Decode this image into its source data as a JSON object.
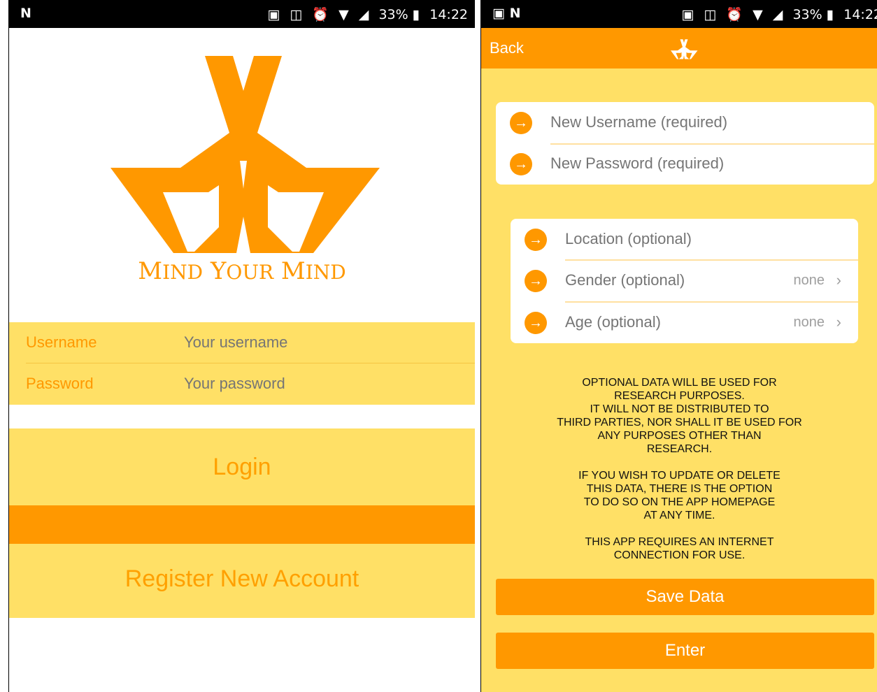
{
  "left": {
    "status": {
      "left_icon": "N",
      "battery": "33%",
      "time": "14:22"
    },
    "logo": {
      "text_big1": "M",
      "text_small1": "IND",
      "text_big2": "Y",
      "text_small2": "OUR",
      "text_big3": "M",
      "text_small3": "IND",
      "color": "#FF9800"
    },
    "username": {
      "label": "Username",
      "placeholder": "Your username"
    },
    "password": {
      "label": "Password",
      "placeholder": "Your password"
    },
    "login_label": "Login",
    "register_label": "Register New Account"
  },
  "right": {
    "status": {
      "left_icons": "▣ N",
      "battery": "33%",
      "time": "14:22"
    },
    "nav": {
      "back_label": "Back"
    },
    "fields1": [
      {
        "label": "New Username (required)"
      },
      {
        "label": "New Password (required)"
      }
    ],
    "fields2": [
      {
        "label": "Location (optional)",
        "value": ""
      },
      {
        "label": "Gender (optional)",
        "value": "none"
      },
      {
        "label": "Age (optional)",
        "value": "none"
      }
    ],
    "notice": {
      "p1_l1": "OPTIONAL DATA WILL BE USED FOR",
      "p1_l2": "RESEARCH PURPOSES.",
      "p1_l3": "IT WILL NOT BE DISTRIBUTED TO",
      "p1_l4": "THIRD PARTIES, NOR SHALL IT BE USED FOR",
      "p1_l5": "ANY PURPOSES OTHER THAN",
      "p1_l6": "RESEARCH.",
      "p2_l1": "IF YOU WISH TO UPDATE OR DELETE",
      "p2_l2": "THIS DATA, THERE IS THE OPTION",
      "p2_l3": "TO DO SO ON THE APP HOMEPAGE",
      "p2_l4": "AT ANY TIME.",
      "p3_l1": "THIS APP REQUIRES AN INTERNET",
      "p3_l2": "CONNECTION FOR USE."
    },
    "save_label": "Save Data",
    "enter_label": "Enter"
  },
  "colors": {
    "accent": "#FF9800",
    "light": "#FFE066",
    "text_gray": "#757575"
  },
  "icons": {
    "status": [
      "nfc-icon",
      "vibrate-icon",
      "alarm-icon",
      "wifi-icon",
      "signal-icon",
      "battery-icon"
    ],
    "field": "arrow-right-circle-icon",
    "row": "chevron-right-icon"
  }
}
